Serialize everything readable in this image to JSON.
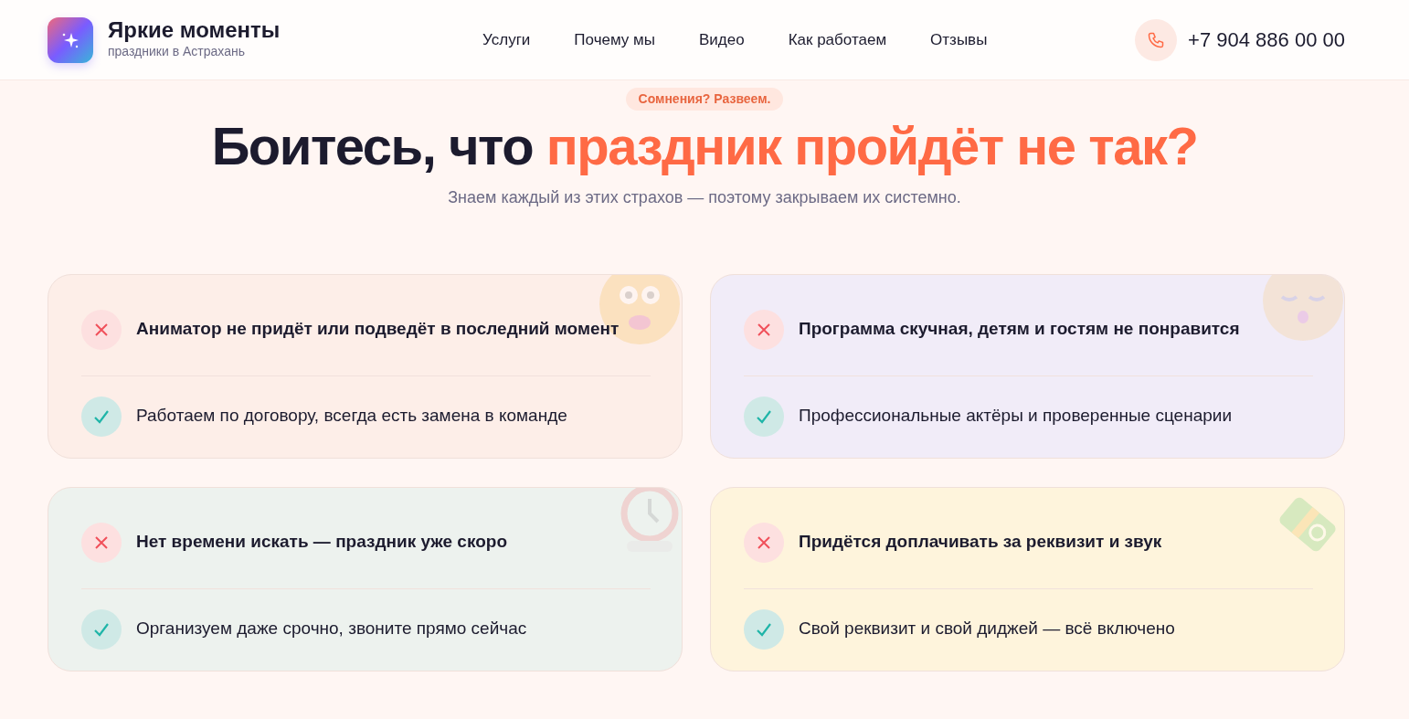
{
  "brand": {
    "name": "Яркие моменты",
    "tagline": "праздники в Астрахань"
  },
  "nav": [
    {
      "label": "Услуги"
    },
    {
      "label": "Почему мы"
    },
    {
      "label": "Видео"
    },
    {
      "label": "Как работаем"
    },
    {
      "label": "Отзывы"
    }
  ],
  "phone": "+7 904 886 00 00",
  "badge": "Сомнения? Развеем.",
  "headline": {
    "plain": "Боитесь, что",
    "accent": "праздник пройдёт не так?"
  },
  "subtitle": "Знаем каждый из этих страхов — поэтому закрываем их системно.",
  "cards": [
    {
      "color": "#fdeee8",
      "kind": "scared-face",
      "fear": "Аниматор не придёт или подведёт в последний момент",
      "answer": "Работаем по договору, всегда есть замена в команде"
    },
    {
      "color": "#f1ecf8",
      "kind": "sleepy-face",
      "fear": "Программа скучная, детям и гостям не понравится",
      "answer": "Профессиональные актёры и проверенные сценарии"
    },
    {
      "color": "#edf2ee",
      "kind": "alarm-clock",
      "fear": "Нет времени искать — праздник уже скоро",
      "answer": "Организуем даже срочно, звоните прямо сейчас"
    },
    {
      "color": "#fef4dc",
      "kind": "money",
      "fear": "Придётся доплачивать за реквизит и звук",
      "answer": "Свой реквизит и свой диджей — всё включено"
    }
  ]
}
